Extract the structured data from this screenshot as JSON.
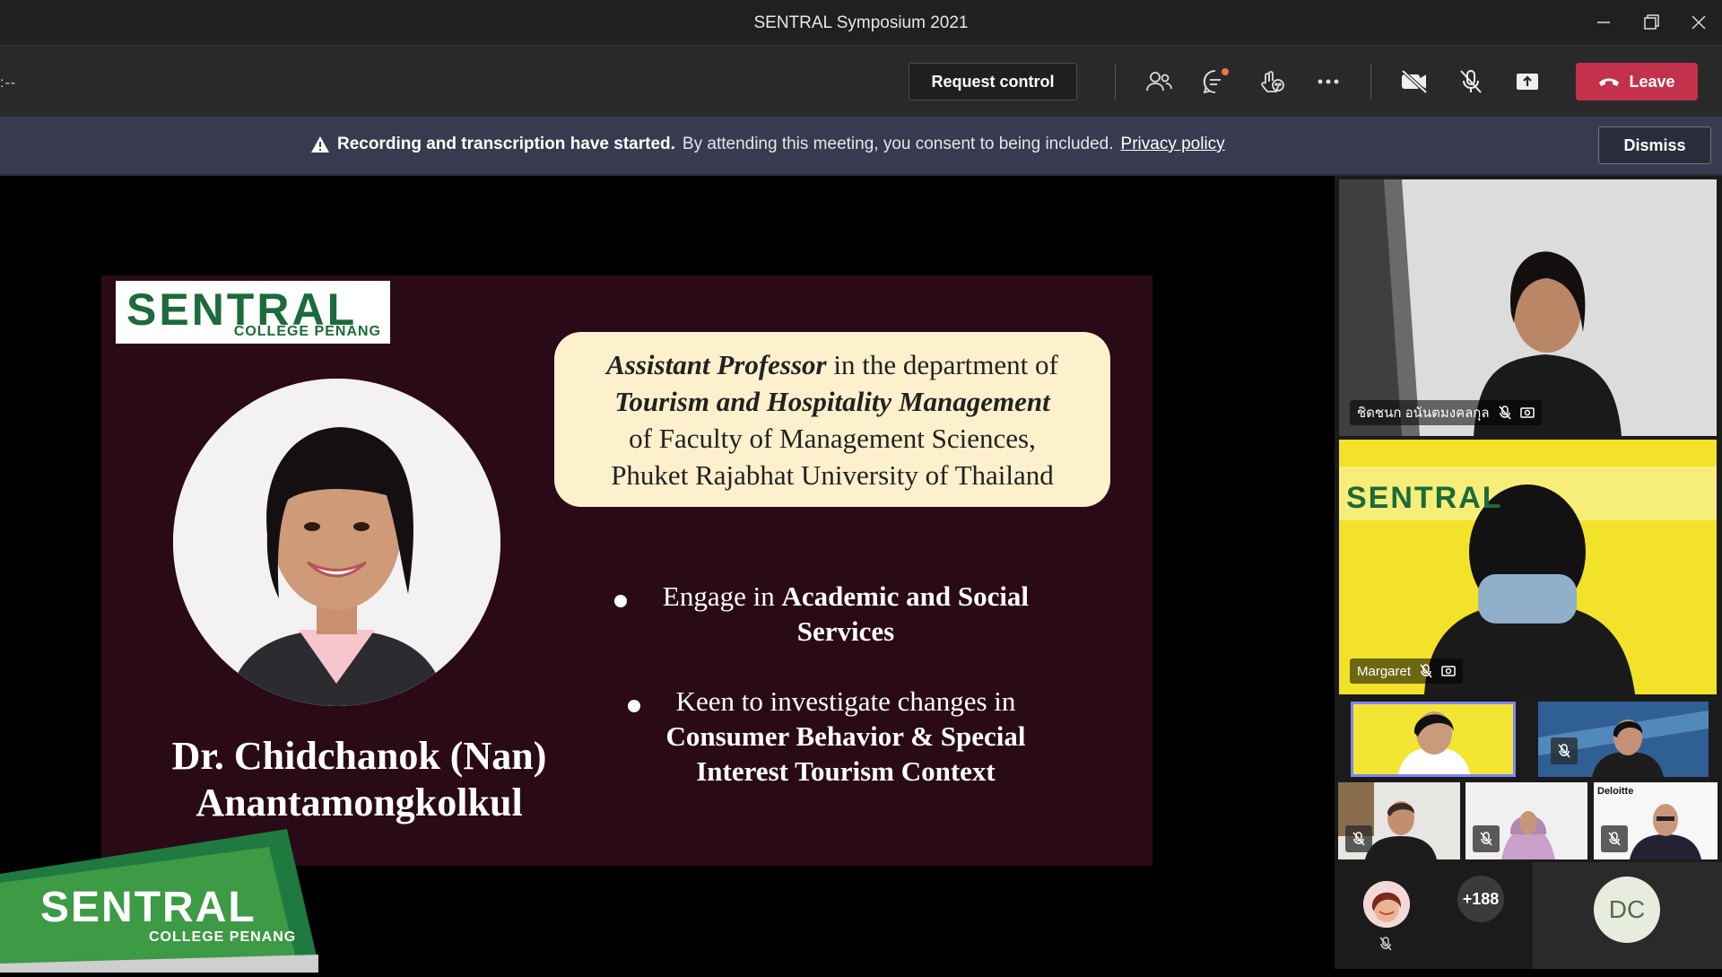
{
  "window": {
    "title": "SENTRAL Symposium 2021"
  },
  "toolbar": {
    "timer": ":--",
    "request_control": "Request control",
    "leave": "Leave",
    "icons": [
      "participants-icon",
      "chat-icon",
      "reactions-icon",
      "more-icon",
      "camera-off-icon",
      "mic-off-icon",
      "share-icon"
    ]
  },
  "banner": {
    "bold": "Recording and transcription have started.",
    "text": "By attending this meeting, you consent to being included.",
    "link": "Privacy policy",
    "dismiss": "Dismiss"
  },
  "slide": {
    "logo_main": "SENTRAL",
    "logo_sub": "COLLEGE PENANG",
    "speaker_name_1": "Dr. Chidchanok (Nan)",
    "speaker_name_2": "Anantamongkolkul",
    "info_title_italic": "Assistant Professor",
    "info_line1_rest": " in the department of",
    "info_line2": "Tourism and Hospitality Management",
    "info_line3": "of Faculty of Management Sciences,",
    "info_line4": "Phuket Rajabhat University of Thailand",
    "bullet1_text": "Engage in ",
    "bullet1_bold_a": "Academic and Social",
    "bullet1_bold_b": "Services",
    "bullet2_text": "Keen to investigate changes in",
    "bullet2_bold_a": "Consumer Behavior & Special",
    "bullet2_bold_b": "Interest Tourism Context"
  },
  "corner_logo": {
    "main": "SENTRAL",
    "sub": "COLLEGE PENANG"
  },
  "participants": {
    "tile1_name": "ชิดชนก อนันตมงคลกุล",
    "tile2_name": "Margaret",
    "tile2_bg_text": "SENTRAL",
    "thumb_labels": [
      "Deloitte"
    ],
    "more_count": "+188",
    "self_initials": "DC"
  },
  "colors": {
    "leave": "#c4314b",
    "banner": "#393a4f",
    "slide_bg": "#2a0a17",
    "info_box": "#fdf0cc",
    "logo_green": "#1c6b3a"
  }
}
